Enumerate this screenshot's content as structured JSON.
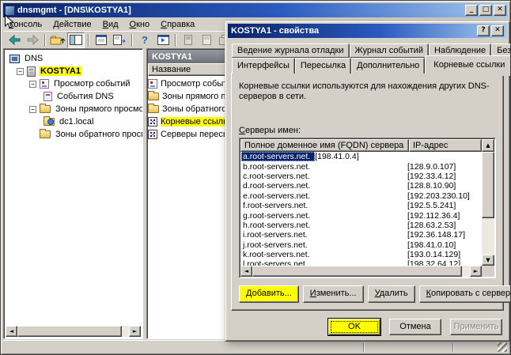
{
  "window": {
    "title": "dnsmgmt - [DNS\\KOSTYA1]"
  },
  "glyphs": {
    "minimize": "_",
    "maximize": "□",
    "close": "✕",
    "help": "?",
    "up": "▲",
    "down": "▼",
    "left": "◄",
    "right": "►",
    "expand_open": "−"
  },
  "menu": {
    "items": [
      "Консоль",
      "Действие",
      "Вид",
      "Окно",
      "Справка"
    ]
  },
  "toolbar": {
    "icons": [
      "back",
      "forward",
      "up-one-level",
      "show-hide-console-tree",
      "properties",
      "export-list",
      "help",
      "show-in-new-window",
      "server",
      "document",
      "copy-window"
    ]
  },
  "tree": {
    "root": "DNS",
    "nodes": [
      "KOSTYA1",
      "Просмотр событий",
      "События DNS",
      "Зоны прямого просмотра",
      "dc1.local",
      "Зоны обратного просмотра"
    ]
  },
  "result_pane": {
    "header": "KOSTYA1",
    "column_header": "Название",
    "items": [
      "Просмотр событий",
      "Зоны прямого просмотра",
      "Зоны обратного просмотра",
      "Корневые ссылки",
      "Серверы пересылки"
    ]
  },
  "dialog": {
    "title": "KOSTYA1 - свойства",
    "tabs_row1": [
      "Ведение журнала отладки",
      "Журнал событий",
      "Наблюдение",
      "Безопасность"
    ],
    "tabs_row2": [
      "Интерфейсы",
      "Пересылка",
      "Дополнительно",
      "Корневые ссылки"
    ],
    "active_tab": "Корневые ссылки",
    "description": "Корневые ссылки используются для нахождения других DNS-серверов в сети.",
    "name_servers_label": "Серверы имен:",
    "list": {
      "columns": [
        "Полное доменное имя (FQDN) сервера",
        "IP-адрес"
      ],
      "selected_row": "a.root-servers.net.",
      "rows": [
        {
          "fqdn": "a.root-servers.net.",
          "ip": "[198.41.0.4]"
        },
        {
          "fqdn": "b.root-servers.net.",
          "ip": "[128.9.0.107]"
        },
        {
          "fqdn": "c.root-servers.net.",
          "ip": "[192.33.4.12]"
        },
        {
          "fqdn": "d.root-servers.net.",
          "ip": "[128.8.10.90]"
        },
        {
          "fqdn": "e.root-servers.net.",
          "ip": "[192.203.230.10]"
        },
        {
          "fqdn": "f.root-servers.net.",
          "ip": "[192.5.5.241]"
        },
        {
          "fqdn": "g.root-servers.net.",
          "ip": "[192.112.36.4]"
        },
        {
          "fqdn": "h.root-servers.net.",
          "ip": "[128.63.2.53]"
        },
        {
          "fqdn": "i.root-servers.net.",
          "ip": "[192.36.148.17]"
        },
        {
          "fqdn": "j.root-servers.net.",
          "ip": "[198.41.0.10]"
        },
        {
          "fqdn": "k.root-servers.net.",
          "ip": "[193.0.14.129]"
        },
        {
          "fqdn": "l.root-servers.net.",
          "ip": "[198.32.64.12]"
        }
      ]
    },
    "buttons": {
      "add": "Добавить...",
      "edit": "Изменить...",
      "remove": "Удалить",
      "copy_from_server": "Копировать с сервера"
    },
    "footer": {
      "ok": "OK",
      "cancel": "Отмена",
      "apply": "Применить"
    }
  },
  "colors": {
    "chrome": "#d4d0c8",
    "titlebar_start": "#0a246a",
    "titlebar_end": "#a6caf0",
    "selection": "#0a246a",
    "annotation_highlight": "#ffff00"
  }
}
